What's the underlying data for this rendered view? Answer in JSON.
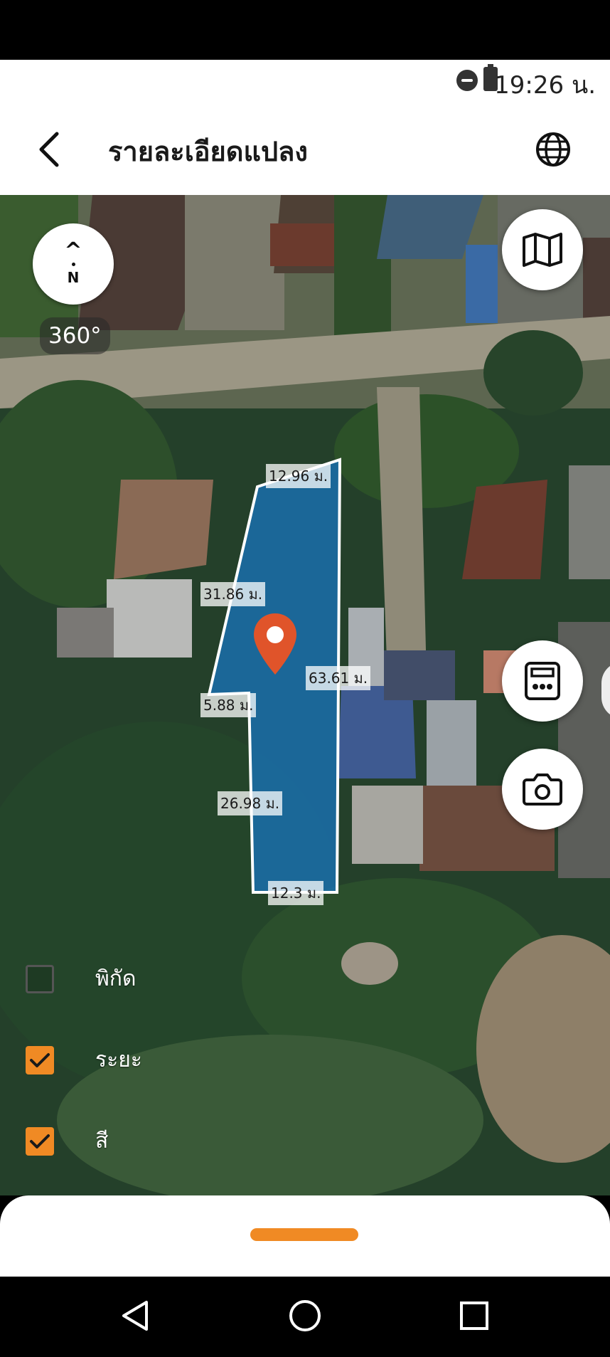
{
  "status_bar": {
    "time": "19:26 น."
  },
  "header": {
    "title": "รายละเอียดแปลง"
  },
  "map": {
    "compass_letter": "N",
    "view_mode": "360°",
    "marker_color": "#e0542a",
    "parcel_fill": "#1877c8",
    "measurements": {
      "top": "12.96 ม.",
      "left_upper": "31.86 ม.",
      "right": "63.61 ม.",
      "notch": "5.88 ม.",
      "left_lower": "26.98 ม.",
      "bottom": "12.3 ม."
    }
  },
  "layers": [
    {
      "label": "พิกัด",
      "checked": false
    },
    {
      "label": "ระยะ",
      "checked": true
    },
    {
      "label": "สี",
      "checked": true
    }
  ],
  "buttons": {
    "map_type": "map-icon",
    "calculator": "calculator-icon",
    "camera": "camera-icon"
  },
  "colors": {
    "accent": "#f08a24"
  }
}
